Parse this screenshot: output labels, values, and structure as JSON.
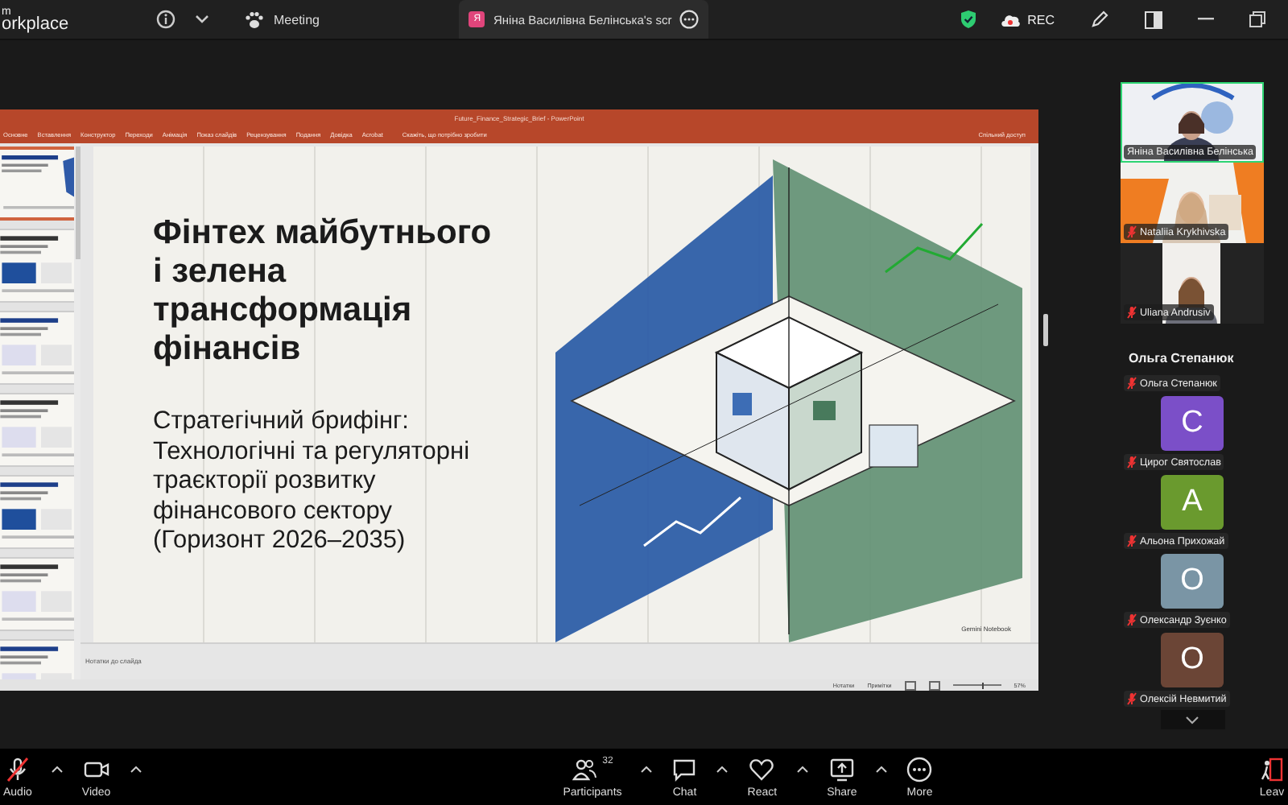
{
  "top_bar": {
    "logo_top": "m",
    "logo": "orkplace",
    "meeting_label": "Meeting",
    "share_tab": {
      "badge": "Я",
      "title": "Яніна Василівна Белінська's scr"
    },
    "rec_label": "REC"
  },
  "powerpoint": {
    "title": "Future_Finance_Strategic_Brief - PowerPoint",
    "tabs": [
      "Основне",
      "Вставлення",
      "Конструктор",
      "Переходи",
      "Анімація",
      "Показ слайдів",
      "Рецензування",
      "Подання",
      "Довідка",
      "Acrobat"
    ],
    "search_hint": "Скажіть, що потрібно зробити",
    "share_label": "Спільний доступ",
    "thumbnails": [
      {
        "selected": true
      },
      {
        "selected": false
      },
      {
        "selected": false
      },
      {
        "selected": false
      },
      {
        "selected": false
      },
      {
        "selected": false
      },
      {
        "selected": false
      }
    ],
    "slide": {
      "title_lines": [
        "Фінтех майбутнього",
        "і зелена",
        "трансформація",
        "фінансів"
      ],
      "subtitle_lines": [
        "Стратегічний брифінг:",
        "Технологічні та регуляторні",
        "траєкторії розвитку",
        "фінансового сектору",
        "(Горизонт 2026–2035)"
      ],
      "footer": "Gemini Notebook"
    },
    "notes_placeholder": "Нотатки до слайда",
    "status": {
      "notes": "Нотатки",
      "comments": "Примітки",
      "zoom_slider": {
        "level": 0.6
      },
      "zoom": "57%"
    }
  },
  "speaker_name": "Ольга Степанюк",
  "participants": [
    {
      "kind": "video",
      "name": "Яніна Василівна Белінська",
      "speaking": true,
      "muted": false
    },
    {
      "kind": "video",
      "name": "Nataliia Krykhivska",
      "speaking": false,
      "muted": true
    },
    {
      "kind": "video",
      "name": "Uliana Andrusiv",
      "speaking": false,
      "muted": true
    },
    {
      "kind": "name",
      "name": "Ольга Степанюк",
      "muted": true
    },
    {
      "kind": "avatar",
      "initial": "C",
      "name": "Цирог Святослав",
      "color": "#7b4fc8",
      "muted": true
    },
    {
      "kind": "avatar",
      "initial": "A",
      "name": "Альона Прихожай",
      "color": "#6a9a2e",
      "muted": true
    },
    {
      "kind": "avatar",
      "initial": "O",
      "name": "Олександр Зуєнко",
      "color": "#7a95a5",
      "muted": true
    },
    {
      "kind": "avatar",
      "initial": "O",
      "name": "Олексій Невмитий",
      "color": "#6b4536",
      "muted": true
    }
  ],
  "toolbar": [
    {
      "kind": "audio",
      "label": "Audio",
      "menu": true
    },
    {
      "kind": "video",
      "label": "Video",
      "menu": true
    },
    {
      "kind": "participants",
      "label": "Participants",
      "count": "32",
      "menu": true
    },
    {
      "kind": "chat",
      "label": "Chat",
      "menu": true
    },
    {
      "kind": "react",
      "label": "React",
      "menu": true
    },
    {
      "kind": "share",
      "label": "Share",
      "menu": true
    },
    {
      "kind": "more",
      "label": "More"
    },
    {
      "kind": "leave",
      "label": "Leav"
    }
  ]
}
